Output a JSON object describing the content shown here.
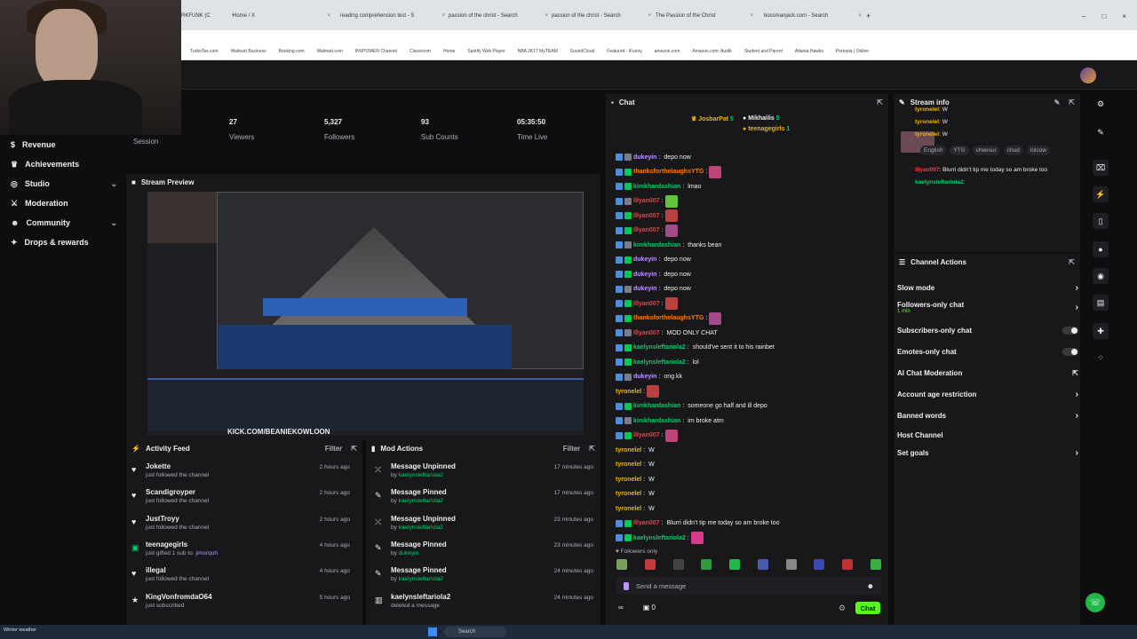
{
  "browser": {
    "tabs": [
      {
        "label": "RKFUNK (C"
      },
      {
        "label": "Home / X"
      },
      {
        "label": "reading comprehension test - S"
      },
      {
        "label": "passion of the christ - Search"
      },
      {
        "label": "passion of the christ - Search"
      },
      {
        "label": "The Passion of the Christ"
      },
      {
        "label": "bossmanjack.com - Search"
      }
    ],
    "bookmarks": [
      "TurboTax.com",
      "Walmart Business",
      "Booking.com",
      "Walmart.com",
      "INVPOWER Channel",
      "Classroom",
      "Home",
      "Spotify Web Player",
      "NBA 2K17 MyTEAM",
      "SoundCloud",
      "Featured - iFunny",
      "amazon.com",
      "Amazon.com: Audib",
      "Student and Parent",
      "Atlanta Hawks",
      "Portopia | Online"
    ]
  },
  "sidebar": {
    "partial_label": "Session",
    "items": [
      {
        "label": "Revenue",
        "icon": "dollar-icon",
        "chevron": false
      },
      {
        "label": "Achievements",
        "icon": "trophy-icon",
        "chevron": false
      },
      {
        "label": "Studio",
        "icon": "studio-icon",
        "chevron": true
      },
      {
        "label": "Moderation",
        "icon": "sword-icon",
        "chevron": false
      },
      {
        "label": "Community",
        "icon": "people-icon",
        "chevron": true
      },
      {
        "label": "Drops & rewards",
        "icon": "gift-icon",
        "chevron": false
      }
    ]
  },
  "stats": [
    {
      "value": "27",
      "label": "Viewers"
    },
    {
      "value": "5,327",
      "label": "Followers"
    },
    {
      "value": "93",
      "label": "Sub Counts"
    },
    {
      "value": "05:35:50",
      "label": "Time Live"
    }
  ],
  "preview": {
    "title": "Stream Preview",
    "overlay_text": "KICK.COM/BEANIEKOWLOON"
  },
  "activity_feed": {
    "title": "Activity Feed",
    "filter": "Filter",
    "items": [
      {
        "name": "Jokette",
        "sub": "just followed the channel",
        "time": "2 hours ago",
        "icon": "heart-icon"
      },
      {
        "name": "Scandigroyper",
        "sub": "just followed the channel",
        "time": "2 hours ago",
        "icon": "heart-icon"
      },
      {
        "name": "JustTroyy",
        "sub": "just followed the channel",
        "time": "2 hours ago",
        "icon": "heart-icon"
      },
      {
        "name": "teenagegirls",
        "sub": "just gifted 1 sub to:",
        "sub_user": "jimsrquh",
        "time": "4 hours ago",
        "icon": "gift-sub-icon"
      },
      {
        "name": "illegal",
        "sub": "just followed the channel",
        "time": "4 hours ago",
        "icon": "heart-icon"
      },
      {
        "name": "KingVonfromdaO64",
        "sub": "just subscribed",
        "time": "5 hours ago",
        "icon": "star-icon"
      }
    ]
  },
  "mod_actions": {
    "title": "Mod Actions",
    "filter": "Filter",
    "items": [
      {
        "action": "Message Unpinned",
        "by": "kaelynsleftariola2",
        "time": "17 minutes ago",
        "icon": "unpin-icon"
      },
      {
        "action": "Message Pinned",
        "by": "kaelynsleftariola2",
        "time": "17 minutes ago",
        "icon": "pin-icon"
      },
      {
        "action": "Message Unpinned",
        "by": "kaelynsleftariola2",
        "time": "23 minutes ago",
        "icon": "unpin-icon"
      },
      {
        "action": "Message Pinned",
        "by": "dukeyin",
        "time": "23 minutes ago",
        "icon": "pin-icon"
      },
      {
        "action": "Message Pinned",
        "by": "kaelynsleftariola2",
        "time": "24 minutes ago",
        "icon": "pin-icon"
      },
      {
        "action": "kaelynsleftariola2",
        "by": "deleted a message",
        "time": "24 minutes ago",
        "icon": "trash-icon"
      }
    ]
  },
  "chat": {
    "title": "Chat",
    "top_gifters": [
      {
        "name": "JosbarPat",
        "count": "5"
      },
      {
        "name": "Mikhailis",
        "count": "5"
      },
      {
        "name": "teenagegirls",
        "count": "1"
      }
    ],
    "messages": [
      {
        "user": "dukeyin",
        "color": "#bf94ff",
        "text": "depo now",
        "emote": false
      },
      {
        "user": "thanksforthelaughsYTG",
        "color": "#ff7b00",
        "text": "",
        "emote": true
      },
      {
        "user": "kimkhardashian",
        "color": "#00d26a",
        "text": "lmao",
        "emote": false
      },
      {
        "user": "Illyan007",
        "color": "#ff3b3b",
        "text": "",
        "emote": true
      },
      {
        "user": "Illyan007",
        "color": "#ff3b3b",
        "text": "",
        "emote": true
      },
      {
        "user": "Illyan007",
        "color": "#ff3b3b",
        "text": "",
        "emote": true
      },
      {
        "user": "kimkhardashian",
        "color": "#00d26a",
        "text": "thanks bean",
        "emote": false
      },
      {
        "user": "dukeyin",
        "color": "#bf94ff",
        "text": "depo now",
        "emote": false
      },
      {
        "user": "dukeyin",
        "color": "#bf94ff",
        "text": "depo now",
        "emote": false
      },
      {
        "user": "dukeyin",
        "color": "#bf94ff",
        "text": "depo now",
        "emote": false
      },
      {
        "user": "Illyan007",
        "color": "#ff3b3b",
        "text": "",
        "emote": true
      },
      {
        "user": "thanksforthelaughsYTG",
        "color": "#ff7b00",
        "text": "",
        "emote": true
      },
      {
        "user": "Illyan007",
        "color": "#ff3b3b",
        "text": "MOD ONLY CHAT",
        "emote": false
      },
      {
        "user": "kaelynsleftariola2",
        "color": "#00d26a",
        "text": "should've sent it to his rainbet",
        "emote": false
      },
      {
        "user": "kaelynsleftariola2",
        "color": "#00d26a",
        "text": "lol",
        "emote": false
      },
      {
        "user": "dukeyin",
        "color": "#bf94ff",
        "text": "ong kk",
        "emote": false
      },
      {
        "user": "tyronelel",
        "color": "#f0b400",
        "text": "",
        "emote": true
      },
      {
        "user": "kimkhardashian",
        "color": "#00d26a",
        "text": "someone go half and ill depo",
        "emote": false
      },
      {
        "user": "kimkhardashian",
        "color": "#00d26a",
        "text": "im broke atm",
        "emote": false
      },
      {
        "user": "Illyan007",
        "color": "#ff3b3b",
        "text": "",
        "emote": true
      },
      {
        "user": "tyronelel",
        "color": "#f0b400",
        "text": "W",
        "emote": false
      },
      {
        "user": "tyronelel",
        "color": "#f0b400",
        "text": "W",
        "emote": false
      },
      {
        "user": "tyronelel",
        "color": "#f0b400",
        "text": "W",
        "emote": false
      },
      {
        "user": "tyronelel",
        "color": "#f0b400",
        "text": "W",
        "emote": false
      },
      {
        "user": "tyronelel",
        "color": "#f0b400",
        "text": "W",
        "emote": false
      },
      {
        "user": "Illyan007",
        "color": "#ff3b3b",
        "text": "Blurri didn't tip me today so am broke too",
        "emote": false
      },
      {
        "user": "kaelynsleftariola2",
        "color": "#00d26a",
        "text": "",
        "emote": true
      }
    ],
    "followers_only": "Followers only",
    "input_placeholder": "Send a message",
    "points": "0",
    "send_label": "Chat"
  },
  "stream_info": {
    "title": "Stream info",
    "tags": [
      "English",
      "YTG",
      "cheesur",
      "chud",
      "lolcow"
    ],
    "overlay_lines": [
      {
        "user": "tyronelel",
        "text": "W"
      },
      {
        "user": "tyronelel",
        "text": "W"
      },
      {
        "user": "tyronelel",
        "text": "W"
      },
      {
        "user": "Illyan007",
        "text": "Blurri didn't tip me today so am broke too"
      },
      {
        "user": "kaelynsleftariola2",
        "text": ""
      }
    ]
  },
  "channel_actions": {
    "title": "Channel Actions",
    "items": [
      {
        "label": "Slow mode",
        "kind": "arrow",
        "sub": ""
      },
      {
        "label": "Followers-only chat",
        "kind": "arrow",
        "sub": "1 min"
      },
      {
        "label": "Subscribers-only chat",
        "kind": "toggle",
        "sub": ""
      },
      {
        "label": "Emotes-only chat",
        "kind": "toggle",
        "sub": ""
      },
      {
        "label": "AI Chat Moderation",
        "kind": "external",
        "sub": ""
      },
      {
        "label": "Account age restriction",
        "kind": "arrow",
        "sub": ""
      },
      {
        "label": "Banned words",
        "kind": "arrow",
        "sub": ""
      },
      {
        "label": "Host Channel",
        "kind": "none",
        "sub": ""
      },
      {
        "label": "Set goals",
        "kind": "arrow",
        "sub": ""
      }
    ]
  },
  "taskbar": {
    "search": "Search",
    "weather": "Winter weather"
  },
  "colors": {
    "accent": "#53fc18",
    "bg": "#0e0e10",
    "panel": "#18181b"
  }
}
